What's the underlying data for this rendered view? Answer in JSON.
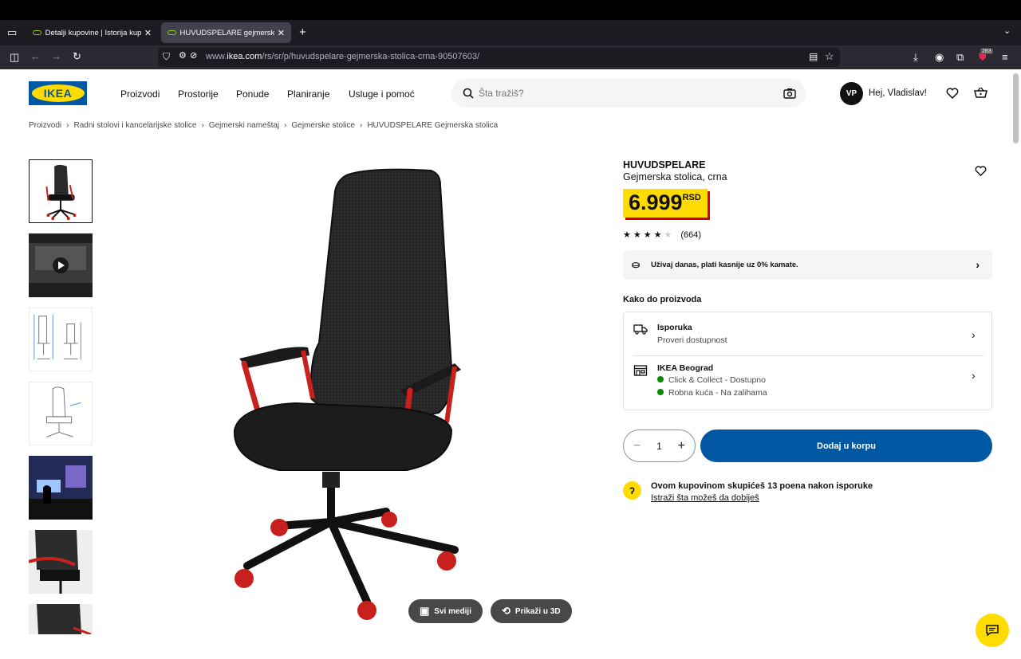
{
  "browser": {
    "tabs": [
      {
        "label": "Detalji kupovine | Istorija kupovi"
      },
      {
        "label": "HUVUDSPELARE gejmerska stolica"
      }
    ],
    "url_prefix": "www.",
    "url_domain": "ikea.com",
    "url_path": "/rs/sr/p/huvudspelare-gejmerska-stolica-crna-90507603/",
    "extension_badge": "283"
  },
  "header": {
    "logo_text": "IKEA",
    "nav": [
      "Proizvodi",
      "Prostorije",
      "Ponude",
      "Planiranje",
      "Usluge i pomoć"
    ],
    "search_placeholder": "Šta tražiš?",
    "avatar_initials": "VP",
    "greeting": "Hej, Vladislav!"
  },
  "breadcrumb": [
    "Proizvodi",
    "Radni stolovi i kancelarijske stolice",
    "Gejmerski nameštaj",
    "Gejmerske stolice",
    "HUVUDSPELARE Gejmerska stolica"
  ],
  "media": {
    "all_media_label": "Svi mediji",
    "view_3d_label": "Prikaži u 3D"
  },
  "product": {
    "name": "HUVUDSPELARE",
    "description": "Gejmerska stolica, crna",
    "price": "6.999",
    "currency": "RSD",
    "rating_stars": 4,
    "review_count": "(664)",
    "credit_text": "Uživaj danas, plati kasnije uz 0% kamate.",
    "how_to_get": "Kako do proizvoda",
    "delivery_title": "Isporuka",
    "delivery_sub": "Proveri dostupnost",
    "store_title": "IKEA Beograd",
    "store_line1": "Click & Collect - Dostupno",
    "store_line2": "Robna kuća - Na zalihama",
    "quantity": "1",
    "add_to_cart": "Dodaj u korpu",
    "points_text": "Ovom kupovinom skupićeš 13 poena nakon isporuke",
    "points_link": "Istraži šta možeš da dobiješ"
  },
  "colors": {
    "ikea_blue": "#0058a3",
    "ikea_yellow": "#ffdb00",
    "price_shadow": "#cc0008",
    "in_stock": "#0a8a00"
  }
}
